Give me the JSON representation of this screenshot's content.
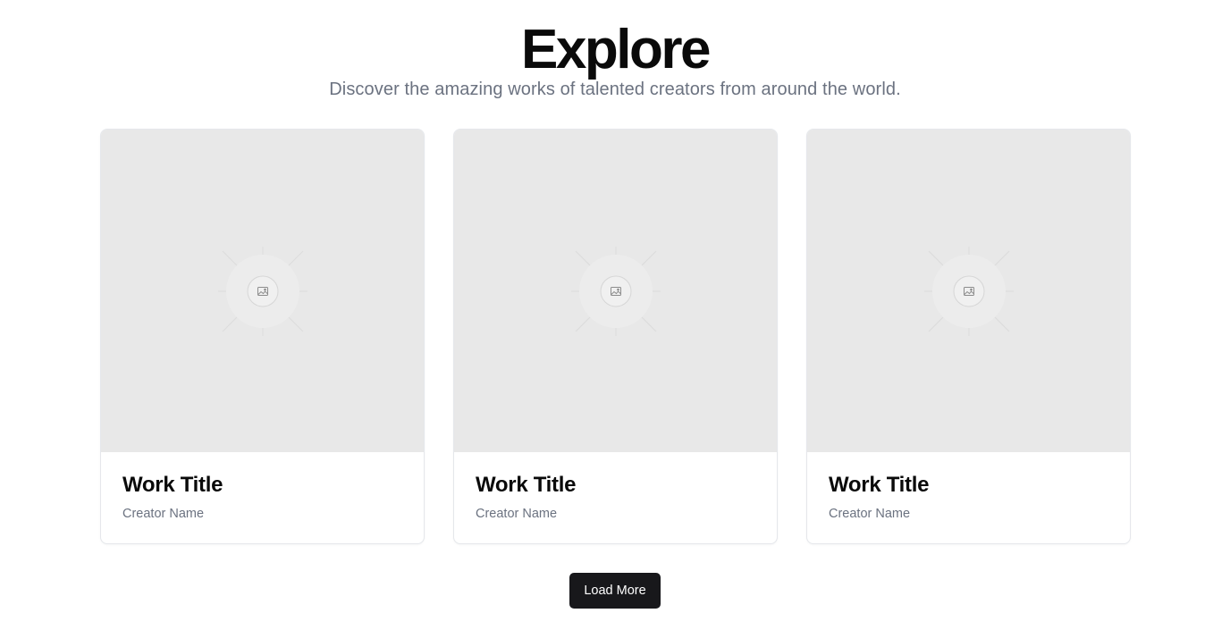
{
  "header": {
    "title": "Explore",
    "subtitle": "Discover the amazing works of talented creators from around the world."
  },
  "cards": [
    {
      "title": "Work Title",
      "creator": "Creator Name",
      "icon": "image-placeholder-icon"
    },
    {
      "title": "Work Title",
      "creator": "Creator Name",
      "icon": "image-placeholder-icon"
    },
    {
      "title": "Work Title",
      "creator": "Creator Name",
      "icon": "image-placeholder-icon"
    }
  ],
  "actions": {
    "load_more_label": "Load More"
  },
  "colors": {
    "button_bg": "#18181b",
    "placeholder_bg": "#e8e8e8",
    "muted_text": "#6b7280"
  }
}
